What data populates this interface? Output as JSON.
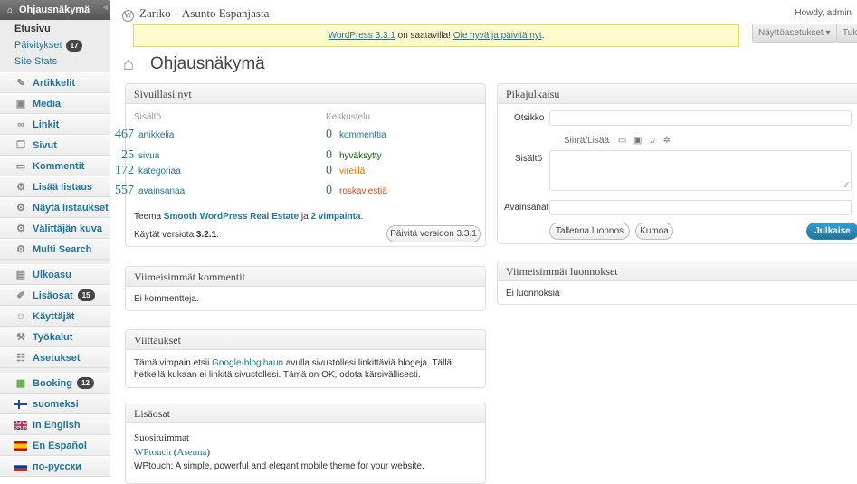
{
  "sidebar": {
    "dashboard": {
      "label": "Ohjausnäkymä",
      "icon": "home-icon"
    },
    "sub": [
      {
        "label": "Etusivu"
      },
      {
        "label": "Päivitykset",
        "badge": "17"
      },
      {
        "label": "Site Stats"
      }
    ],
    "items": [
      {
        "label": "Artikkelit",
        "icon": "pin-icon"
      },
      {
        "label": "Media",
        "icon": "media-icon"
      },
      {
        "label": "Linkit",
        "icon": "link-icon"
      },
      {
        "label": "Sivut",
        "icon": "pages-icon"
      },
      {
        "label": "Kommentit",
        "icon": "comment-icon"
      },
      {
        "label": "Lisää listaus",
        "icon": "gear-icon"
      },
      {
        "label": "Näytä listaukset",
        "icon": "gear-icon"
      },
      {
        "label": "Välittäjän kuva",
        "icon": "gear-icon"
      },
      {
        "label": "Multi Search",
        "icon": "gear-icon"
      },
      {
        "label": "Ulkoasu",
        "icon": "appearance-icon"
      },
      {
        "label": "Lisäosat",
        "icon": "plugin-icon",
        "badge": "15"
      },
      {
        "label": "Käyttäjät",
        "icon": "users-icon"
      },
      {
        "label": "Työkalut",
        "icon": "tools-icon"
      },
      {
        "label": "Asetukset",
        "icon": "settings-icon"
      },
      {
        "label": "Booking",
        "icon": "calendar-icon",
        "badge": "12"
      },
      {
        "label": "suomeksi",
        "icon": "flag-fi-icon"
      },
      {
        "label": "In English",
        "icon": "flag-uk-icon"
      },
      {
        "label": "En Español",
        "icon": "flag-es-icon"
      },
      {
        "label": "по-русски",
        "icon": "flag-ru-icon"
      }
    ]
  },
  "header": {
    "site_title": "Zariko – Asunto Espanjasta",
    "howdy": "Howdy, admin",
    "notice_version": "WordPress 3.3.1",
    "notice_mid": " on saatavilla! ",
    "notice_link": "Ole hyvä ja päivitä nyt",
    "notice_end": ".",
    "screen_options": "Näyttöasetukset ▾",
    "help": "Tuki",
    "page_title": "Ohjausnäkymä"
  },
  "right_now": {
    "title": "Sivuillasi nyt",
    "content_hd": "Sisältö",
    "discussion_hd": "Keskustelu",
    "content": [
      {
        "num": "467",
        "label": "artikkelia"
      },
      {
        "num": "25",
        "label": "sivua"
      },
      {
        "num": "172",
        "label": "kategoriaa"
      },
      {
        "num": "557",
        "label": "avainsanaa"
      }
    ],
    "discussion": [
      {
        "num": "0",
        "label": "kommenttia",
        "color": "#21759b"
      },
      {
        "num": "0",
        "label": "hyväksytty",
        "color": "#006505"
      },
      {
        "num": "0",
        "label": "vireillä",
        "color": "#e66f00"
      },
      {
        "num": "0",
        "label": "roskaviestiä",
        "color": "#d54e21"
      }
    ],
    "theme_pre": "Teema ",
    "theme_name": "Smooth WordPress Real Estate",
    "theme_mid": " ja ",
    "theme_widgets": "2 vimpainta",
    "theme_end": ".",
    "version_pre": "Käytät versiota ",
    "version": "3.2.1",
    "version_end": ".",
    "update_btn": "Päivitä versioon 3.3.1"
  },
  "recent_comments": {
    "title": "Viimeisimmät kommentit",
    "text": "Ei kommentteja."
  },
  "incoming_links": {
    "title": "Viittaukset",
    "pre": "Tämä vimpain etsii ",
    "link": "Google-blogihaun",
    "post": " avulla sivustollesi linkittäviä blogeja. Tällä hetkellä kukaan ei linkitä sivustollesi. Tämä on OK, odota kärsivällisesti."
  },
  "plugins": {
    "title": "Lisäosat",
    "popular": "Suosituimmat",
    "plugin": "WPtouch",
    "install": "Asenna",
    "desc": "WPtouch: A simple, powerful and elegant mobile theme for your website."
  },
  "quick_press": {
    "title": "Pikajulkaisu",
    "title_label": "Otsikko",
    "upload_label": "Siirrä/Lisää",
    "content_label": "Sisältö",
    "tags_label": "Avainsanat",
    "save_btn": "Tallenna luonnos",
    "reset_btn": "Kumoa",
    "publish_btn": "Julkaise"
  },
  "recent_drafts": {
    "title": "Viimeisimmät luonnokset",
    "text": "Ei luonnoksia"
  }
}
